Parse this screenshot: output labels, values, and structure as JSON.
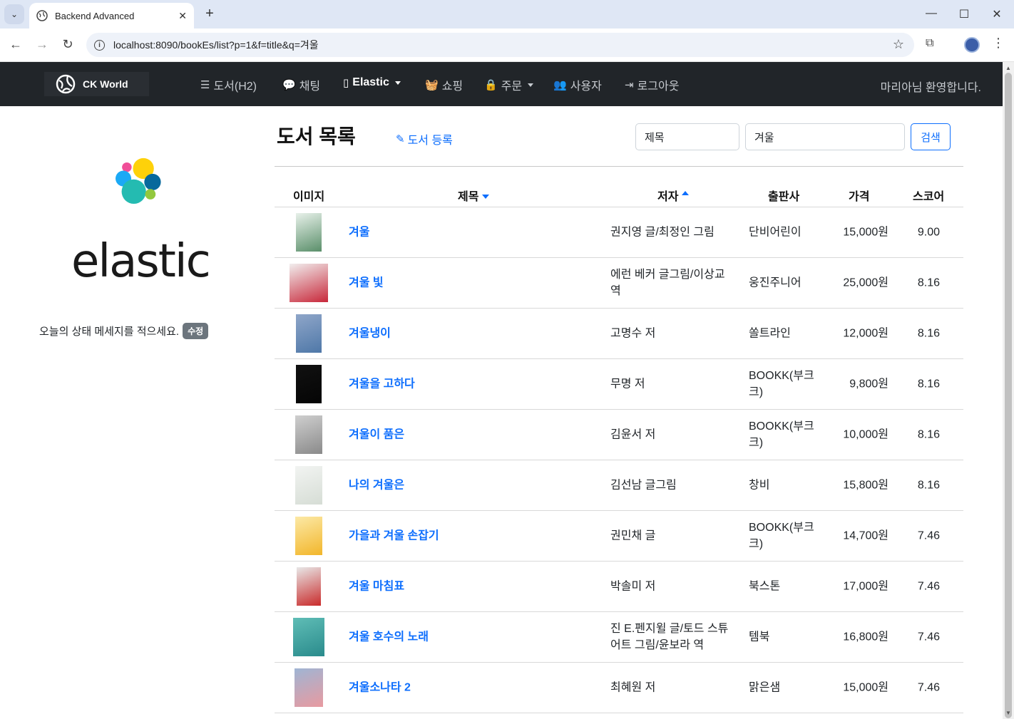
{
  "browser": {
    "tab_title": "Backend Advanced",
    "url": "localhost:8090/bookEs/list?p=1&f=title&q=겨울"
  },
  "navbar": {
    "brand": "CK World",
    "items": [
      {
        "label": "도서(H2)",
        "icon": "list-icon"
      },
      {
        "label": "채팅",
        "icon": "chat-icon"
      },
      {
        "label": "Elastic",
        "icon": "file-icon",
        "active": true,
        "dropdown": true
      },
      {
        "label": "쇼핑",
        "icon": "basket-icon"
      },
      {
        "label": "주문",
        "icon": "bag-icon",
        "dropdown": true
      },
      {
        "label": "사용자",
        "icon": "users-icon"
      },
      {
        "label": "로그아웃",
        "icon": "logout-icon"
      }
    ],
    "welcome": "마리아님 환영합니다."
  },
  "sidebar": {
    "logo_text": "elastic",
    "status_message": "오늘의 상태 메세지를 적으세요.",
    "edit_label": "수정"
  },
  "main": {
    "title": "도서 목록",
    "register_label": "도서 등록",
    "search": {
      "field_selected": "제목",
      "query": "겨울",
      "button": "검색"
    },
    "columns": {
      "image": "이미지",
      "title": "제목",
      "author": "저자",
      "publisher": "출판사",
      "price": "가격",
      "score": "스코어"
    },
    "sort": {
      "title": "desc",
      "author": "asc"
    },
    "accent_color": "#0d6efd",
    "books": [
      {
        "title": "겨울",
        "author": "권지영 글/최정인 그림",
        "publisher": "단비어린이",
        "price": "15,000원",
        "score": "9.00"
      },
      {
        "title": "겨울 빛",
        "author": "에런 베커 글그림/이상교 역",
        "publisher": "웅진주니어",
        "price": "25,000원",
        "score": "8.16"
      },
      {
        "title": "겨울냉이",
        "author": "고명수 저",
        "publisher": "쏠트라인",
        "price": "12,000원",
        "score": "8.16"
      },
      {
        "title": "겨울을 고하다",
        "author": "무명 저",
        "publisher": "BOOKK(부크크)",
        "price": "9,800원",
        "score": "8.16"
      },
      {
        "title": "겨울이 품은",
        "author": "김윤서 저",
        "publisher": "BOOKK(부크크)",
        "price": "10,000원",
        "score": "8.16"
      },
      {
        "title": "나의 겨울은",
        "author": "김선남 글그림",
        "publisher": "창비",
        "price": "15,800원",
        "score": "8.16"
      },
      {
        "title": "가을과 겨울 손잡기",
        "author": "권민채 글",
        "publisher": "BOOKK(부크크)",
        "price": "14,700원",
        "score": "7.46"
      },
      {
        "title": "겨울 마침표",
        "author": "박솔미 저",
        "publisher": "북스톤",
        "price": "17,000원",
        "score": "7.46"
      },
      {
        "title": "겨울 호수의 노래",
        "author": "진 E.펜지윌 글/토드 스튜어트 그림/윤보라 역",
        "publisher": "템북",
        "price": "16,800원",
        "score": "7.46"
      },
      {
        "title": "겨울소나타 2",
        "author": "최혜원 저",
        "publisher": "맑은샘",
        "price": "15,000원",
        "score": "7.46"
      }
    ]
  }
}
